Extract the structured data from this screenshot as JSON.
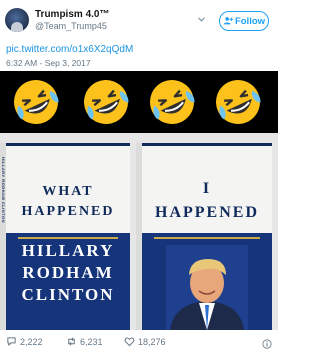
{
  "tweet": {
    "display_name": "Trumpism 4.0™",
    "handle": "@Team_Trump45",
    "link": "pic.twitter.com/o1x6X2qQdM",
    "timestamp": "6:32 AM - Sep 3, 2017"
  },
  "follow_button": {
    "label": "Follow"
  },
  "emoji": {
    "name": "rolling-on-the-floor-laughing",
    "count": 4
  },
  "book_left": {
    "spine": "HILLARY RODHAM CLINTON",
    "title_line1": "WHAT",
    "title_line2": "HAPPENED",
    "author_line1": "HILLARY",
    "author_line2": "RODHAM",
    "author_line3": "CLINTON"
  },
  "book_right": {
    "title_line1": "I",
    "title_line2": "HAPPENED"
  },
  "actions": {
    "replies": "2,222",
    "retweets": "6,231",
    "likes": "18,276"
  },
  "colors": {
    "accent": "#1da1f2",
    "book_navy": "#15347a",
    "like_red": "#e0245e"
  },
  "icons": [
    "chevron-down-icon",
    "follow-user-icon",
    "reply-icon",
    "retweet-icon",
    "heart-icon",
    "info-icon"
  ]
}
